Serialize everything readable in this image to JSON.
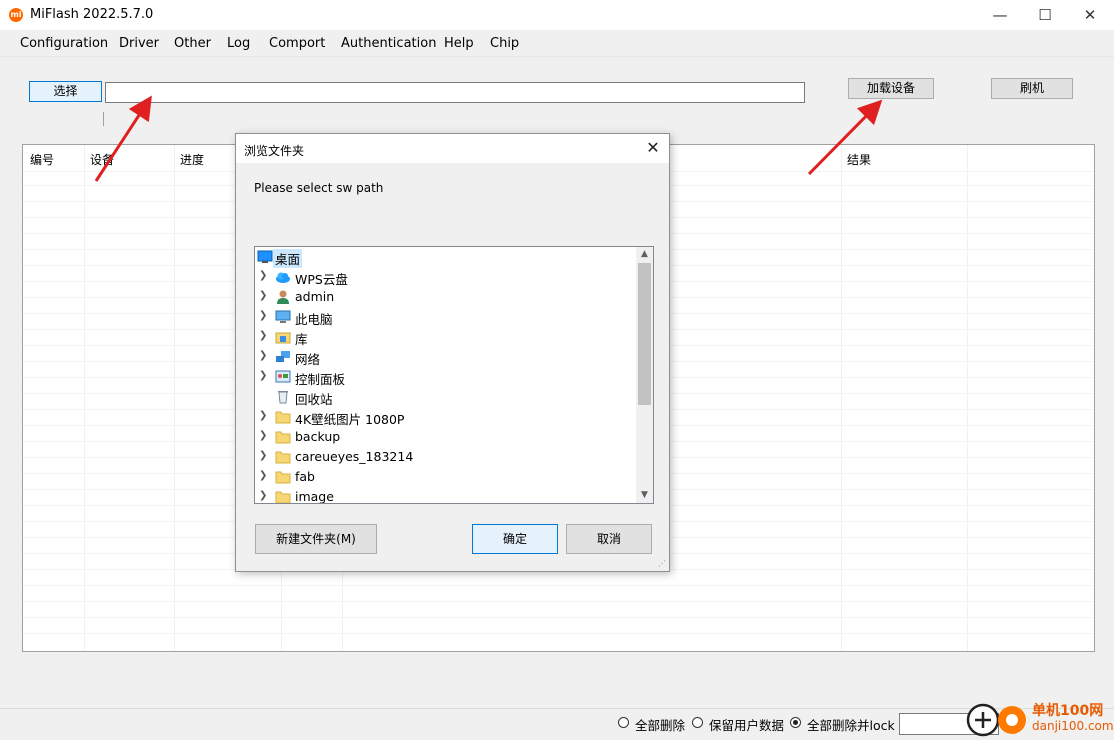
{
  "window": {
    "title": "MiFlash 2022.5.7.0",
    "app_icon_text": "mi",
    "minimize": "—",
    "maximize": "☐",
    "close": "✕"
  },
  "menu": [
    "Configuration",
    "Driver",
    "Other",
    "Log",
    "Comport",
    "Authentication",
    "Help",
    "Chip"
  ],
  "toolbar": {
    "select_label": "选择",
    "path_value": "",
    "load_device_label": "加载设备",
    "flash_label": "刷机"
  },
  "grid": {
    "headers": [
      "编号",
      "设备",
      "进度",
      "结果"
    ]
  },
  "dialog": {
    "title": "浏览文件夹",
    "close": "✕",
    "prompt": "Please select sw path",
    "tree": [
      {
        "label": "桌面",
        "icon": "desktop-icon",
        "expandable": false,
        "selected": true
      },
      {
        "label": "WPS云盘",
        "icon": "cloud-icon",
        "expandable": true
      },
      {
        "label": "admin",
        "icon": "user-icon",
        "expandable": true
      },
      {
        "label": "此电脑",
        "icon": "computer-icon",
        "expandable": true
      },
      {
        "label": "库",
        "icon": "library-icon",
        "expandable": true
      },
      {
        "label": "网络",
        "icon": "network-icon",
        "expandable": true
      },
      {
        "label": "控制面板",
        "icon": "control-panel-icon",
        "expandable": true
      },
      {
        "label": "回收站",
        "icon": "recycle-bin-icon",
        "expandable": false
      },
      {
        "label": "4K壁纸图片 1080P",
        "icon": "folder-icon",
        "expandable": true
      },
      {
        "label": "backup",
        "icon": "folder-icon",
        "expandable": true
      },
      {
        "label": "careueyes_183214",
        "icon": "folder-icon",
        "expandable": true
      },
      {
        "label": "fab",
        "icon": "folder-icon",
        "expandable": true
      },
      {
        "label": "image",
        "icon": "folder-icon",
        "expandable": true
      }
    ],
    "new_folder_label": "新建文件夹(M)",
    "ok_label": "确定",
    "cancel_label": "取消"
  },
  "footer": {
    "options": [
      {
        "label": "全部删除",
        "checked": false
      },
      {
        "label": "保留用户数据",
        "checked": false
      },
      {
        "label": "全部删除并lock",
        "checked": true
      }
    ],
    "combo_value": ""
  },
  "watermark": {
    "line1": "单机100网",
    "line2": "danji100.com"
  },
  "colors": {
    "accent": "#0078d7",
    "arrow": "#e02020",
    "folder": "#f7d774",
    "brand": "#ff6900"
  }
}
